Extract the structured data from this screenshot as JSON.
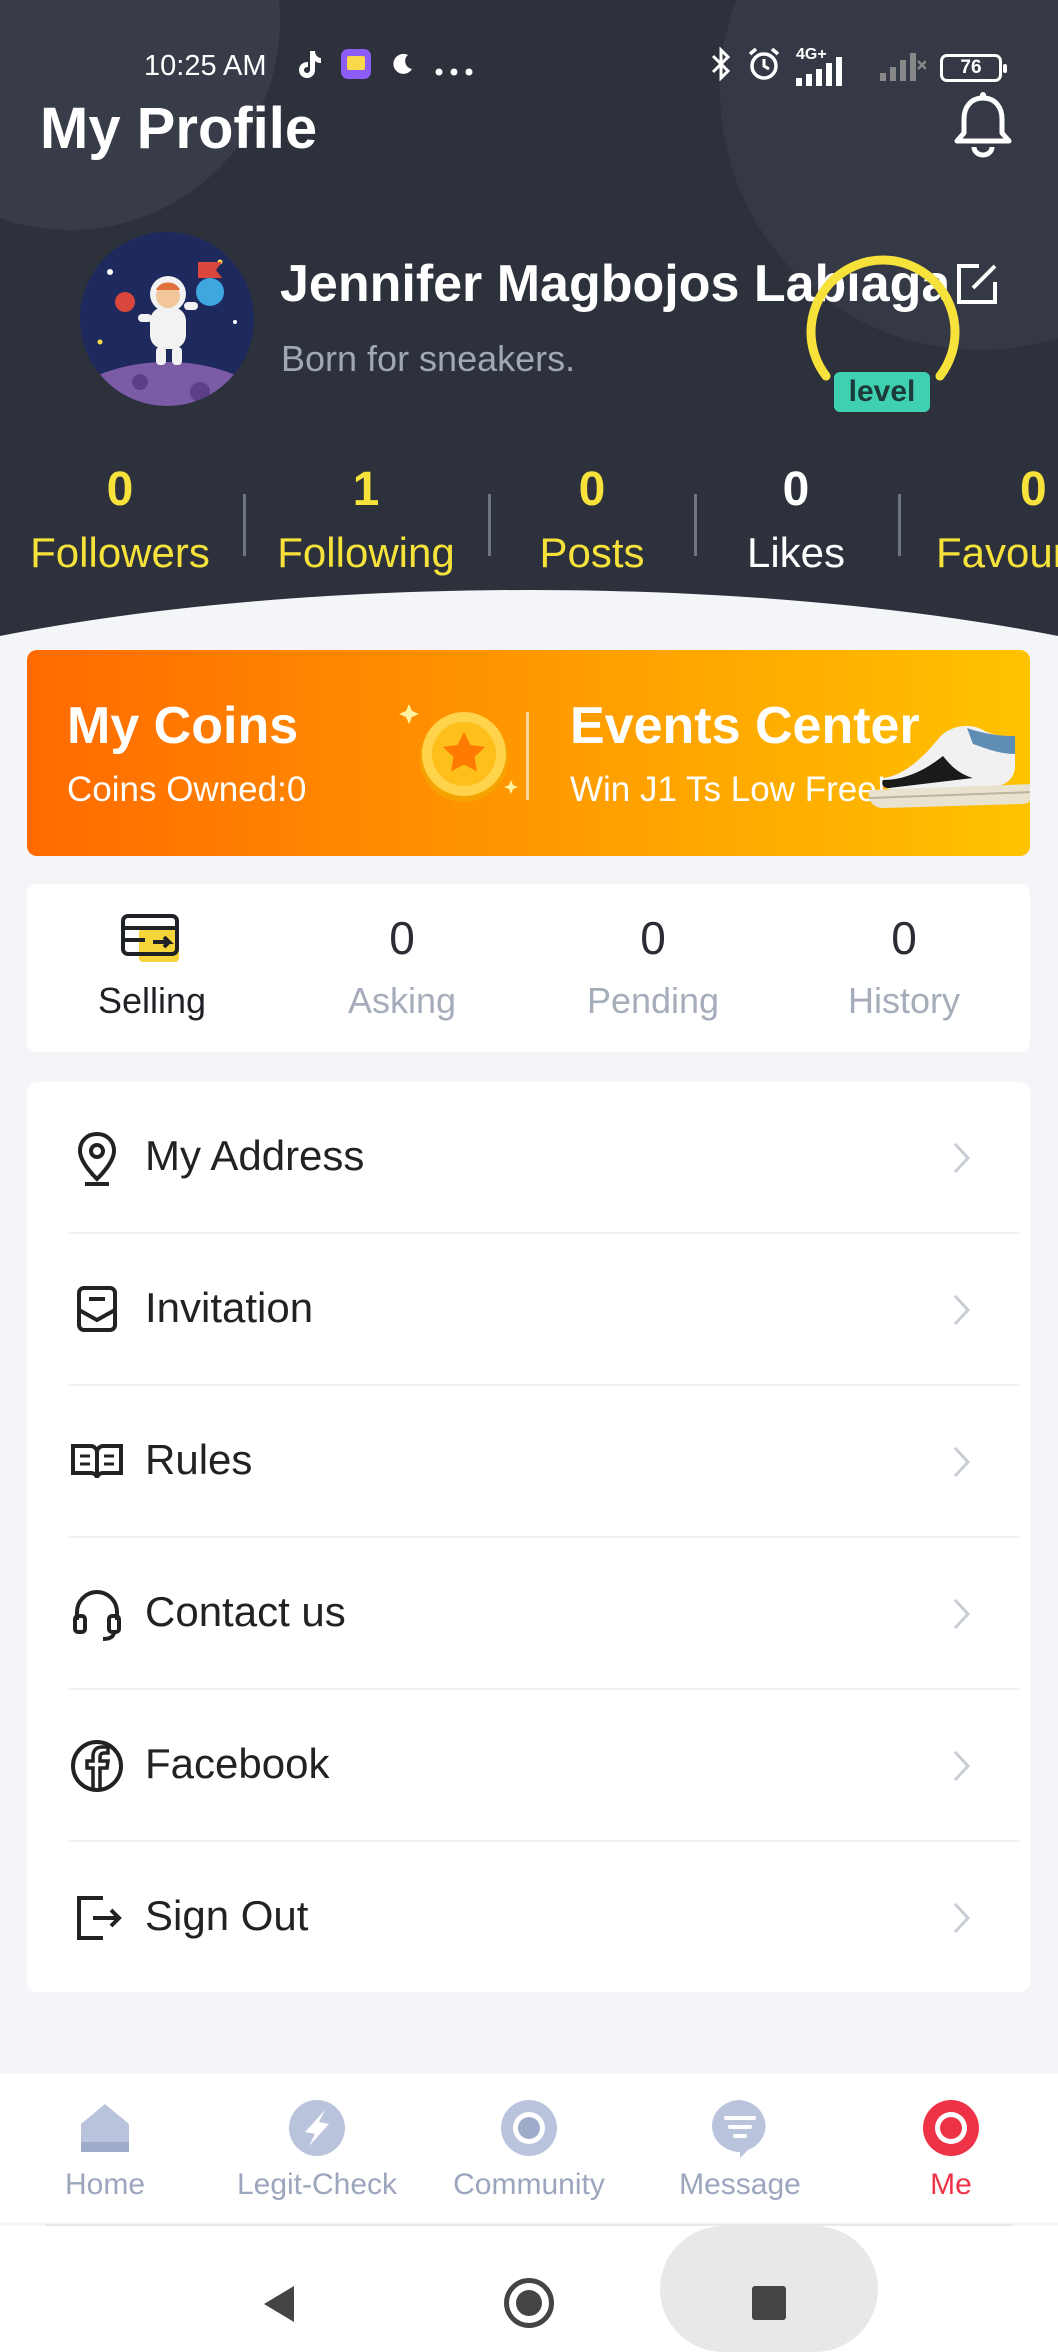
{
  "status_bar": {
    "time": "10:25 AM",
    "network": "4G+",
    "battery": "76"
  },
  "header": {
    "title": "My Profile"
  },
  "profile": {
    "name": "Jennifer Magbojos Labiaga",
    "bio": "Born for sneakers.",
    "level_label": "level"
  },
  "stats": [
    {
      "count": "0",
      "label": "Followers"
    },
    {
      "count": "1",
      "label": "Following"
    },
    {
      "count": "0",
      "label": "Posts"
    },
    {
      "count": "0",
      "label": "Likes"
    },
    {
      "count": "0",
      "label": "Favour"
    }
  ],
  "promo": {
    "coins_title": "My Coins",
    "coins_sub": "Coins Owned:0",
    "events_title": "Events Center",
    "events_sub": "Win J1 Ts Low Free!"
  },
  "tabs": [
    {
      "count": "",
      "label": "Selling"
    },
    {
      "count": "0",
      "label": "Asking"
    },
    {
      "count": "0",
      "label": "Pending"
    },
    {
      "count": "0",
      "label": "History"
    }
  ],
  "menu": [
    {
      "label": "My Address",
      "icon": "location-pin-icon"
    },
    {
      "label": "Invitation",
      "icon": "envelope-icon"
    },
    {
      "label": "Rules",
      "icon": "book-icon"
    },
    {
      "label": "Contact us",
      "icon": "headset-icon"
    },
    {
      "label": "Facebook",
      "icon": "facebook-icon"
    },
    {
      "label": "Sign Out",
      "icon": "sign-out-icon"
    }
  ],
  "bottom_nav": [
    {
      "label": "Home",
      "icon": "home-icon"
    },
    {
      "label": "Legit-Check",
      "icon": "legit-check-icon"
    },
    {
      "label": "Community",
      "icon": "community-icon"
    },
    {
      "label": "Message",
      "icon": "message-icon"
    },
    {
      "label": "Me",
      "icon": "me-icon"
    }
  ],
  "colors": {
    "header_bg": "#2c313c",
    "stat_yellow": "#f6e23a",
    "promo_start": "#ff6a00",
    "promo_end": "#ffc200",
    "active_red": "#ef3347",
    "level_teal": "#3fcfb1"
  }
}
